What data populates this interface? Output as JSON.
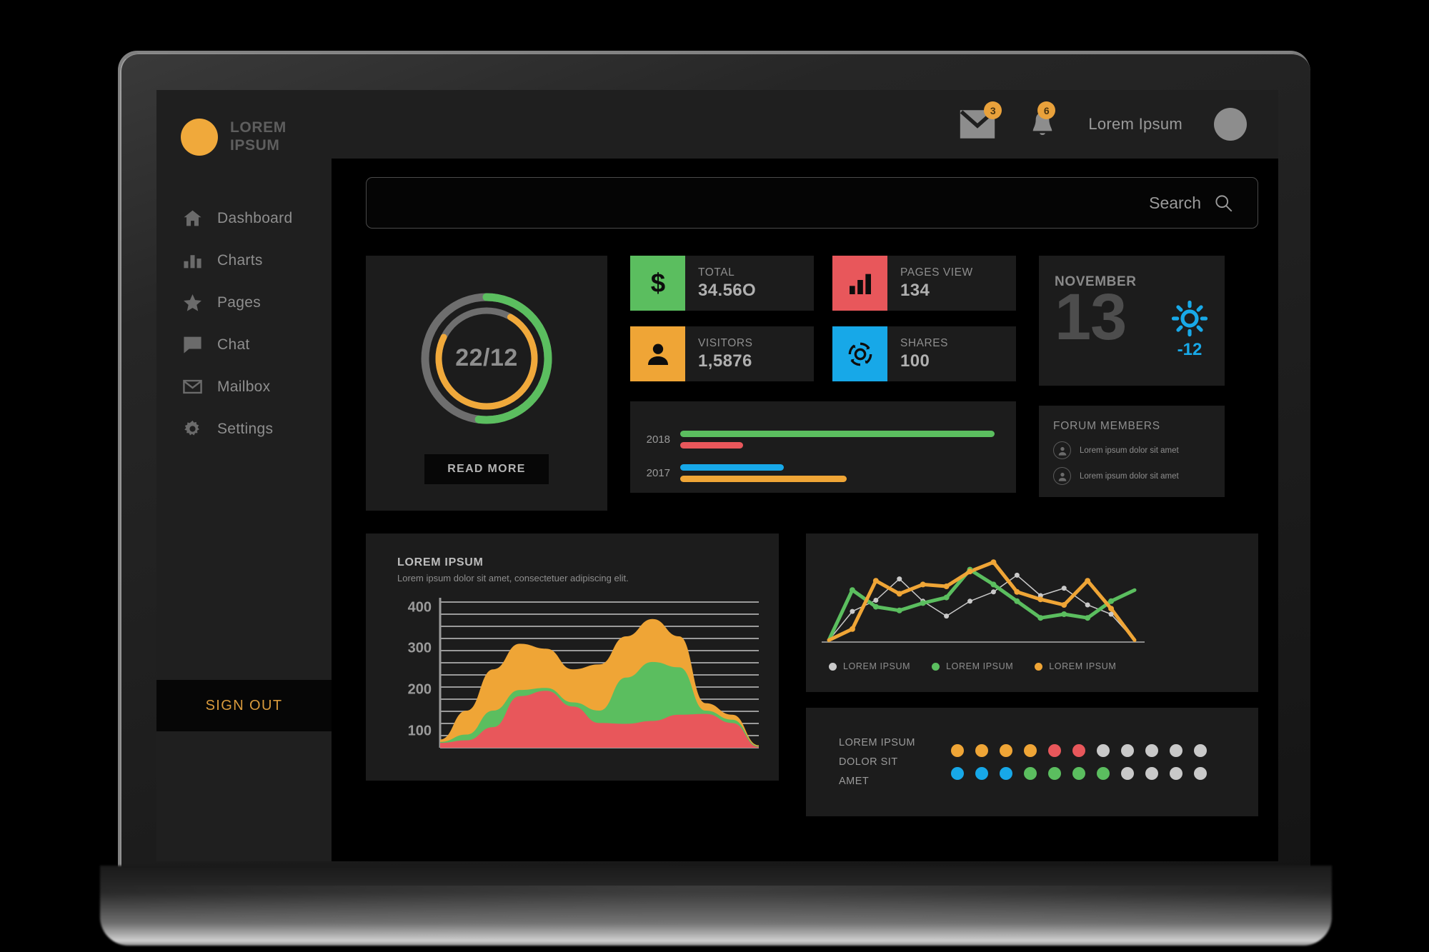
{
  "brand": {
    "line1": "LOREM",
    "line2": "IPSUM"
  },
  "sidebar": {
    "items": [
      {
        "label": "Dashboard",
        "icon": "home-icon"
      },
      {
        "label": "Charts",
        "icon": "bar-chart-icon"
      },
      {
        "label": "Pages",
        "icon": "star-icon"
      },
      {
        "label": "Chat",
        "icon": "chat-icon"
      },
      {
        "label": "Mailbox",
        "icon": "envelope-icon"
      },
      {
        "label": "Settings",
        "icon": "gear-icon"
      }
    ],
    "sign_out": "SIGN OUT"
  },
  "topbar": {
    "mail_badge": "3",
    "bell_badge": "6",
    "user_name": "Lorem Ipsum"
  },
  "search": {
    "label": "Search",
    "value": "",
    "placeholder": ""
  },
  "donut": {
    "value": "22/12",
    "read_more": "READ MORE",
    "outer_pct": 52,
    "inner_pct": 74,
    "outer_color": "#5BBE5F",
    "inner_color": "#F0A93B",
    "track_color": "#6e6e6e"
  },
  "stats": [
    {
      "label": "TOTAL",
      "value": "34.56O",
      "icon": "dollar-icon",
      "color": "#5BBE5F"
    },
    {
      "label": "PAGES VIEW",
      "value": "134",
      "icon": "bar-chart-icon",
      "color": "#E8575B"
    },
    {
      "label": "VISITORS",
      "value": "1,5876",
      "icon": "person-icon",
      "color": "#EFA536"
    },
    {
      "label": "SHARES",
      "value": "100",
      "icon": "share-refresh-icon",
      "color": "#17A8E8"
    }
  ],
  "date_widget": {
    "month": "NOVEMBER",
    "day": "13",
    "temperature": "-12",
    "weather_icon": "sun-icon",
    "accent": "#18A9E8"
  },
  "forum": {
    "title": "FORUM MEMBERS",
    "members": [
      {
        "name": "Lorem ipsum dolor sit amet"
      },
      {
        "name": "Lorem ipsum dolor sit amet"
      }
    ]
  },
  "area_chart_text": {
    "title": "LOREM IPSUM",
    "subtitle": "Lorem ipsum dolor sit amet, consectetuer adipiscing elit."
  },
  "line_legend": [
    {
      "label": "LOREM IPSUM",
      "color": "#c9c9c9"
    },
    {
      "label": "LOREM IPSUM",
      "color": "#5BBE5F"
    },
    {
      "label": "LOREM IPSUM",
      "color": "#EFA536"
    }
  ],
  "dots_panel": {
    "labels": [
      "LOREM IPSUM",
      "DOLOR SIT",
      "AMET"
    ],
    "rows": [
      [
        "#EFA536",
        "#EFA536",
        "#EFA536",
        "#EFA536",
        "#E8575B",
        "#E8575B",
        "#c9c9c9",
        "#c9c9c9",
        "#c9c9c9",
        "#c9c9c9",
        "#c9c9c9"
      ],
      [
        "#17A8E8",
        "#17A8E8",
        "#17A8E8",
        "#5BBE5F",
        "#5BBE5F",
        "#5BBE5F",
        "#5BBE5F",
        "#c9c9c9",
        "#c9c9c9",
        "#c9c9c9",
        "#c9c9c9"
      ]
    ]
  },
  "chart_data": [
    {
      "type": "bar",
      "orientation": "horizontal",
      "title": "",
      "categories": [
        "2018",
        "2017"
      ],
      "series": [
        {
          "name": "2018-a",
          "color": "#5BBE5F",
          "category": "2018",
          "value": 100
        },
        {
          "name": "2018-b",
          "color": "#E8575B",
          "category": "2018",
          "value": 20
        },
        {
          "name": "2017-a",
          "color": "#17A8E8",
          "category": "2017",
          "value": 33
        },
        {
          "name": "2017-b",
          "color": "#EFA536",
          "category": "2017",
          "value": 53
        }
      ],
      "xlim": [
        0,
        100
      ],
      "grid": false
    },
    {
      "type": "area",
      "stacked": true,
      "title": "LOREM IPSUM",
      "subtitle": "Lorem ipsum dolor sit amet, consectetuer adipiscing elit.",
      "xlabel": "",
      "ylabel": "",
      "ylim": [
        60,
        420
      ],
      "yticks": [
        100,
        200,
        300,
        400
      ],
      "grid": true,
      "gridlines": 13,
      "x": [
        0,
        1,
        2,
        3,
        4,
        5,
        6,
        7,
        8,
        9,
        10,
        11,
        12
      ],
      "series": [
        {
          "name": "red",
          "color": "#E8575B",
          "values": [
            72,
            78,
            110,
            185,
            198,
            160,
            120,
            118,
            125,
            140,
            142,
            120,
            62
          ]
        },
        {
          "name": "green",
          "color": "#5BBE5F",
          "values": [
            74,
            92,
            150,
            200,
            205,
            170,
            150,
            230,
            268,
            255,
            150,
            128,
            64
          ]
        },
        {
          "name": "orange",
          "color": "#EFA536",
          "values": [
            80,
            150,
            250,
            312,
            300,
            250,
            262,
            330,
            372,
            330,
            168,
            140,
            66
          ]
        }
      ]
    },
    {
      "type": "line",
      "title": "",
      "grid": false,
      "ylim": [
        0,
        100
      ],
      "x": [
        0,
        1,
        2,
        3,
        4,
        5,
        6,
        7,
        8,
        9,
        10,
        11,
        12,
        13
      ],
      "series": [
        {
          "name": "LOREM IPSUM",
          "color": "#c9c9c9",
          "width": 1.5,
          "marker": 7,
          "values": [
            2,
            33,
            45,
            68,
            44,
            28,
            44,
            54,
            72,
            50,
            58,
            40,
            30,
            2
          ]
        },
        {
          "name": "LOREM IPSUM",
          "color": "#5BBE5F",
          "width": 5,
          "marker": 8,
          "values": [
            2,
            56,
            38,
            34,
            42,
            48,
            78,
            62,
            44,
            26,
            30,
            26,
            44,
            56
          ]
        },
        {
          "name": "LOREM IPSUM",
          "color": "#EFA536",
          "width": 5,
          "marker": 8,
          "values": [
            2,
            14,
            66,
            52,
            62,
            60,
            76,
            86,
            54,
            46,
            40,
            66,
            36,
            2
          ]
        }
      ]
    }
  ]
}
